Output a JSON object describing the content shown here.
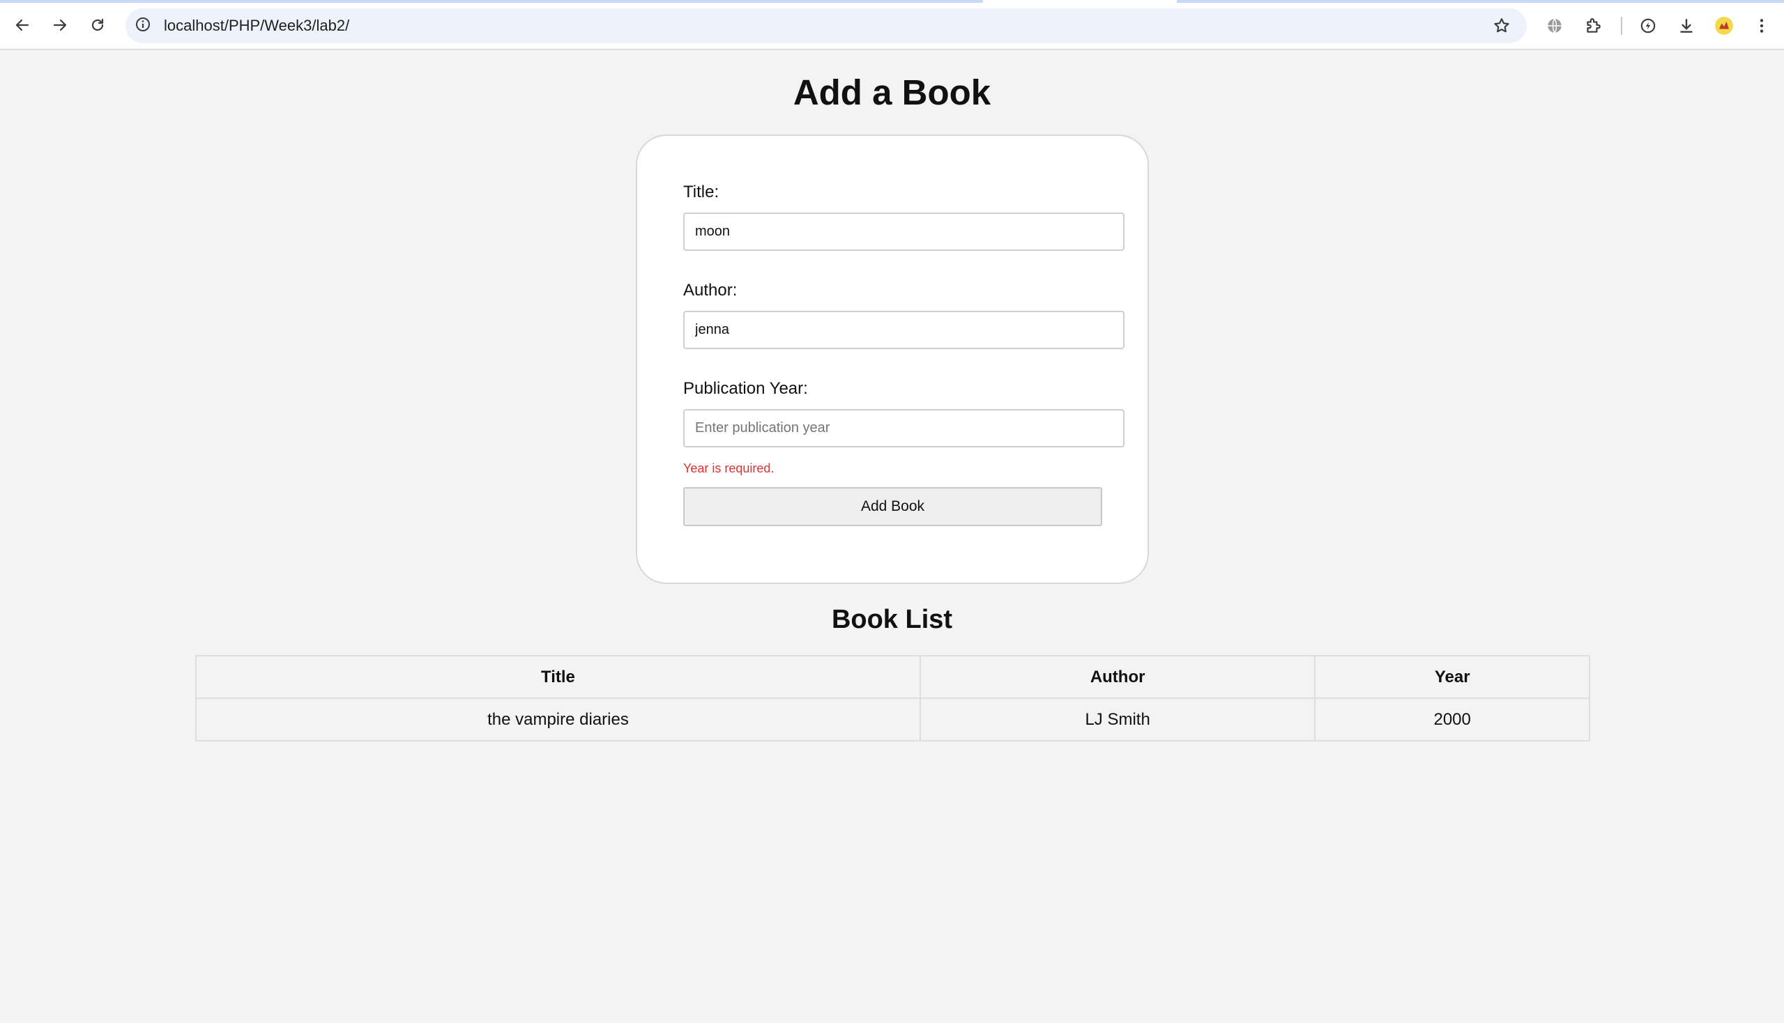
{
  "browser": {
    "url": "localhost/PHP/Week3/lab2/",
    "icons": [
      "back-arrow-icon",
      "forward-arrow-icon",
      "reload-icon",
      "site-info-icon",
      "bookmark-star-icon",
      "translate-globe-icon",
      "extensions-puzzle-icon",
      "performance-icon",
      "download-icon",
      "profile-avatar-icon",
      "more-menu-icon"
    ]
  },
  "page": {
    "heading": "Add a Book"
  },
  "form": {
    "title_label": "Title:",
    "title_value": "moon",
    "author_label": "Author:",
    "author_value": "jenna",
    "year_label": "Publication Year:",
    "year_value": "",
    "year_placeholder": "Enter publication year",
    "year_error": "Year is required.",
    "submit_label": "Add Book"
  },
  "book_list": {
    "heading": "Book List",
    "columns": [
      "Title",
      "Author",
      "Year"
    ],
    "rows": [
      {
        "title": "the vampire diaries",
        "author": "LJ Smith",
        "year": "2000"
      }
    ]
  },
  "colors": {
    "page_bg": "#f3f3f3",
    "error": "#e03131",
    "omnibox_bg": "#eef2fb"
  }
}
